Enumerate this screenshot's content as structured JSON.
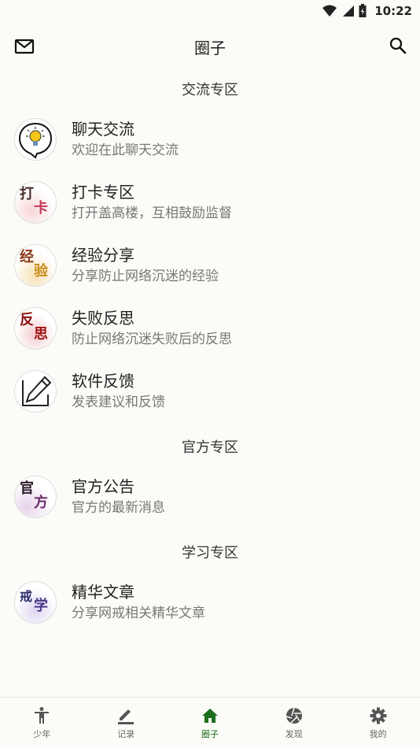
{
  "status": {
    "time": "10:22"
  },
  "header": {
    "title": "圈子"
  },
  "sections": [
    {
      "title": "交流专区"
    },
    {
      "title": "官方专区"
    },
    {
      "title": "学习专区"
    }
  ],
  "items": [
    {
      "title": "聊天交流",
      "subtitle": "欢迎在此聊天交流",
      "icon": "lightbulb-icon"
    },
    {
      "title": "打卡专区",
      "subtitle": "打开盖高楼，互相鼓励监督",
      "icon": "checkin-calligraphy-icon",
      "glyphs": [
        "打",
        "卡"
      ]
    },
    {
      "title": "经验分享",
      "subtitle": "分享防止网络沉迷的经验",
      "icon": "experience-calligraphy-icon",
      "glyphs": [
        "经",
        "验"
      ]
    },
    {
      "title": "失败反思",
      "subtitle": "防止网络沉迷失败后的反思",
      "icon": "reflection-calligraphy-icon",
      "glyphs": [
        "反",
        "思"
      ]
    },
    {
      "title": "软件反馈",
      "subtitle": "发表建议和反馈",
      "icon": "pencil-edit-icon"
    },
    {
      "title": "官方公告",
      "subtitle": "官方的最新消息",
      "icon": "official-calligraphy-icon",
      "glyphs": [
        "官",
        "方"
      ]
    },
    {
      "title": "精华文章",
      "subtitle": "分享网戒相关精华文章",
      "icon": "study-calligraphy-icon",
      "glyphs": [
        "戒",
        "学"
      ]
    }
  ],
  "nav": [
    {
      "label": "少年",
      "icon": "person-icon"
    },
    {
      "label": "记录",
      "icon": "edit-icon"
    },
    {
      "label": "圈子",
      "icon": "home-icon",
      "active": true
    },
    {
      "label": "发现",
      "icon": "aperture-icon"
    },
    {
      "label": "我的",
      "icon": "settings-icon"
    }
  ],
  "colors": {
    "accent": "#1b6e1b",
    "background": "#fbfcf7"
  }
}
